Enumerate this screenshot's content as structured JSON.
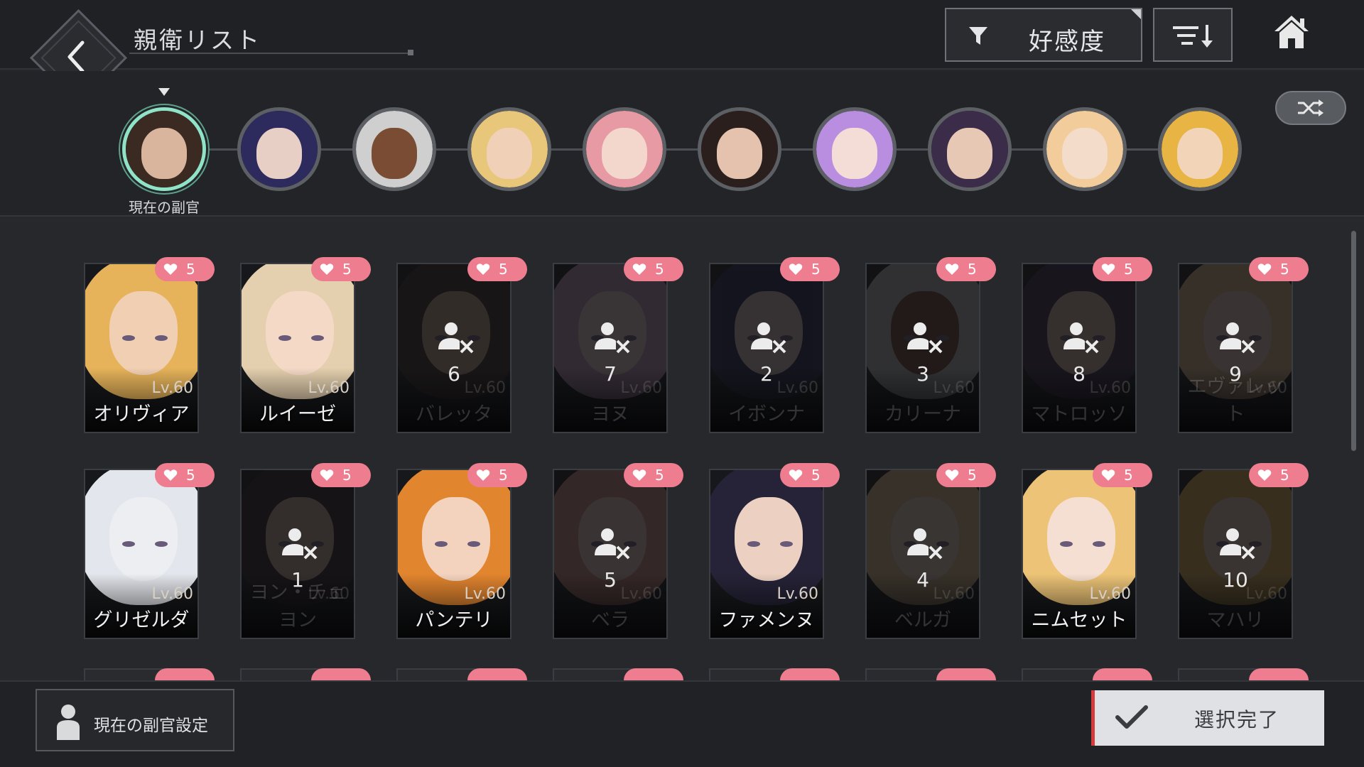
{
  "header": {
    "title": "親衛リスト",
    "filter_label": "好感度",
    "icons": {
      "back": "back-arrow-icon",
      "filter": "filter-icon",
      "sort": "sort-descending-icon",
      "home": "home-icon"
    }
  },
  "ribbon": {
    "current_caption": "現在の副官",
    "avatars": [
      {
        "hair": "#3a2a22",
        "skin": "#d8b59c",
        "selected": true
      },
      {
        "hair": "#2d2a5e",
        "skin": "#e8cfc6"
      },
      {
        "hair": "#cfcfcf",
        "skin": "#7a4c33"
      },
      {
        "hair": "#e8c77a",
        "skin": "#f0d1b8"
      },
      {
        "hair": "#e79aa3",
        "skin": "#f3d6cc"
      },
      {
        "hair": "#2b1f1d",
        "skin": "#e4c2ad"
      },
      {
        "hair": "#b98ee0",
        "skin": "#f3ddd6"
      },
      {
        "hair": "#3b2c4a",
        "skin": "#e7c8b4"
      },
      {
        "hair": "#f2cc9a",
        "skin": "#f4dccb"
      },
      {
        "hair": "#e8b444",
        "skin": "#f2d4b9"
      }
    ],
    "shuffle_icon": "shuffle-icon"
  },
  "cards": [
    {
      "name": "オリヴィア",
      "level": "Lv.60",
      "affection": "5",
      "locked": false,
      "rank": "",
      "hair": "#e6b35a",
      "skin": "#f1cfb3"
    },
    {
      "name": "ルイーゼ",
      "level": "Lv.60",
      "affection": "5",
      "locked": false,
      "rank": "",
      "hair": "#e4cfae",
      "skin": "#f4d9c6"
    },
    {
      "name": "バレッタ",
      "level": "Lv.60",
      "affection": "5",
      "locked": true,
      "rank": "6",
      "hair": "#3d2a22",
      "skin": "#caa48c"
    },
    {
      "name": "ヨヌ",
      "level": "Lv.60",
      "affection": "5",
      "locked": true,
      "rank": "7",
      "hair": "#c79bc2",
      "skin": "#f0d2cc"
    },
    {
      "name": "イボンナ",
      "level": "Lv.60",
      "affection": "5",
      "locked": true,
      "rank": "2",
      "hair": "#26264a",
      "skin": "#e1c4bb"
    },
    {
      "name": "カリーナ",
      "level": "Lv.60",
      "affection": "5",
      "locked": true,
      "rank": "3",
      "hair": "#bdbdbd",
      "skin": "#6d452e"
    },
    {
      "name": "マトロッソ",
      "level": "Lv.60",
      "affection": "5",
      "locked": true,
      "rank": "8",
      "hair": "#3b2a48",
      "skin": "#d8b7a2"
    },
    {
      "name": "エヴァレット",
      "level": "Lv.60",
      "affection": "5",
      "locked": true,
      "rank": "9",
      "hair": "#e3b98a",
      "skin": "#f1d4c0"
    },
    {
      "name": "グリゼルダ",
      "level": "Lv.60",
      "affection": "5",
      "locked": false,
      "rank": "",
      "hair": "#e3e6ec",
      "skin": "#eceef2"
    },
    {
      "name": "ヨン・チェヨン",
      "level": "Lv.60",
      "affection": "5",
      "locked": true,
      "rank": "1",
      "hair": "#2a1f1c",
      "skin": "#cfae98"
    },
    {
      "name": "パンテリ",
      "level": "Lv.60",
      "affection": "5",
      "locked": false,
      "rank": "",
      "hair": "#e2852f",
      "skin": "#f3d3be"
    },
    {
      "name": "ベラ",
      "level": "Lv.60",
      "affection": "5",
      "locked": true,
      "rank": "5",
      "hair": "#d58b7e",
      "skin": "#efd0c2"
    },
    {
      "name": "ファメンヌ",
      "level": "Lv.60",
      "affection": "5",
      "locked": false,
      "rank": "",
      "hair": "#262338",
      "skin": "#ecd1c2"
    },
    {
      "name": "ベルガ",
      "level": "Lv.60",
      "affection": "5",
      "locked": true,
      "rank": "4",
      "hair": "#e3c286",
      "skin": "#f1d6c2"
    },
    {
      "name": "ニムセット",
      "level": "Lv.60",
      "affection": "5",
      "locked": false,
      "rank": "",
      "hair": "#edc477",
      "skin": "#f5dfd2"
    },
    {
      "name": "マハリ",
      "level": "Lv.60",
      "affection": "5",
      "locked": true,
      "rank": "10",
      "hair": "#e4b24e",
      "skin": "#f0d1b6"
    }
  ],
  "footer": {
    "deputy_label": "現在の副官設定",
    "confirm_label": "選択完了"
  },
  "colors": {
    "badge": "#ee7e8f",
    "selected_ring": "#8fe3c6",
    "confirm_accent": "#d63a3a"
  }
}
